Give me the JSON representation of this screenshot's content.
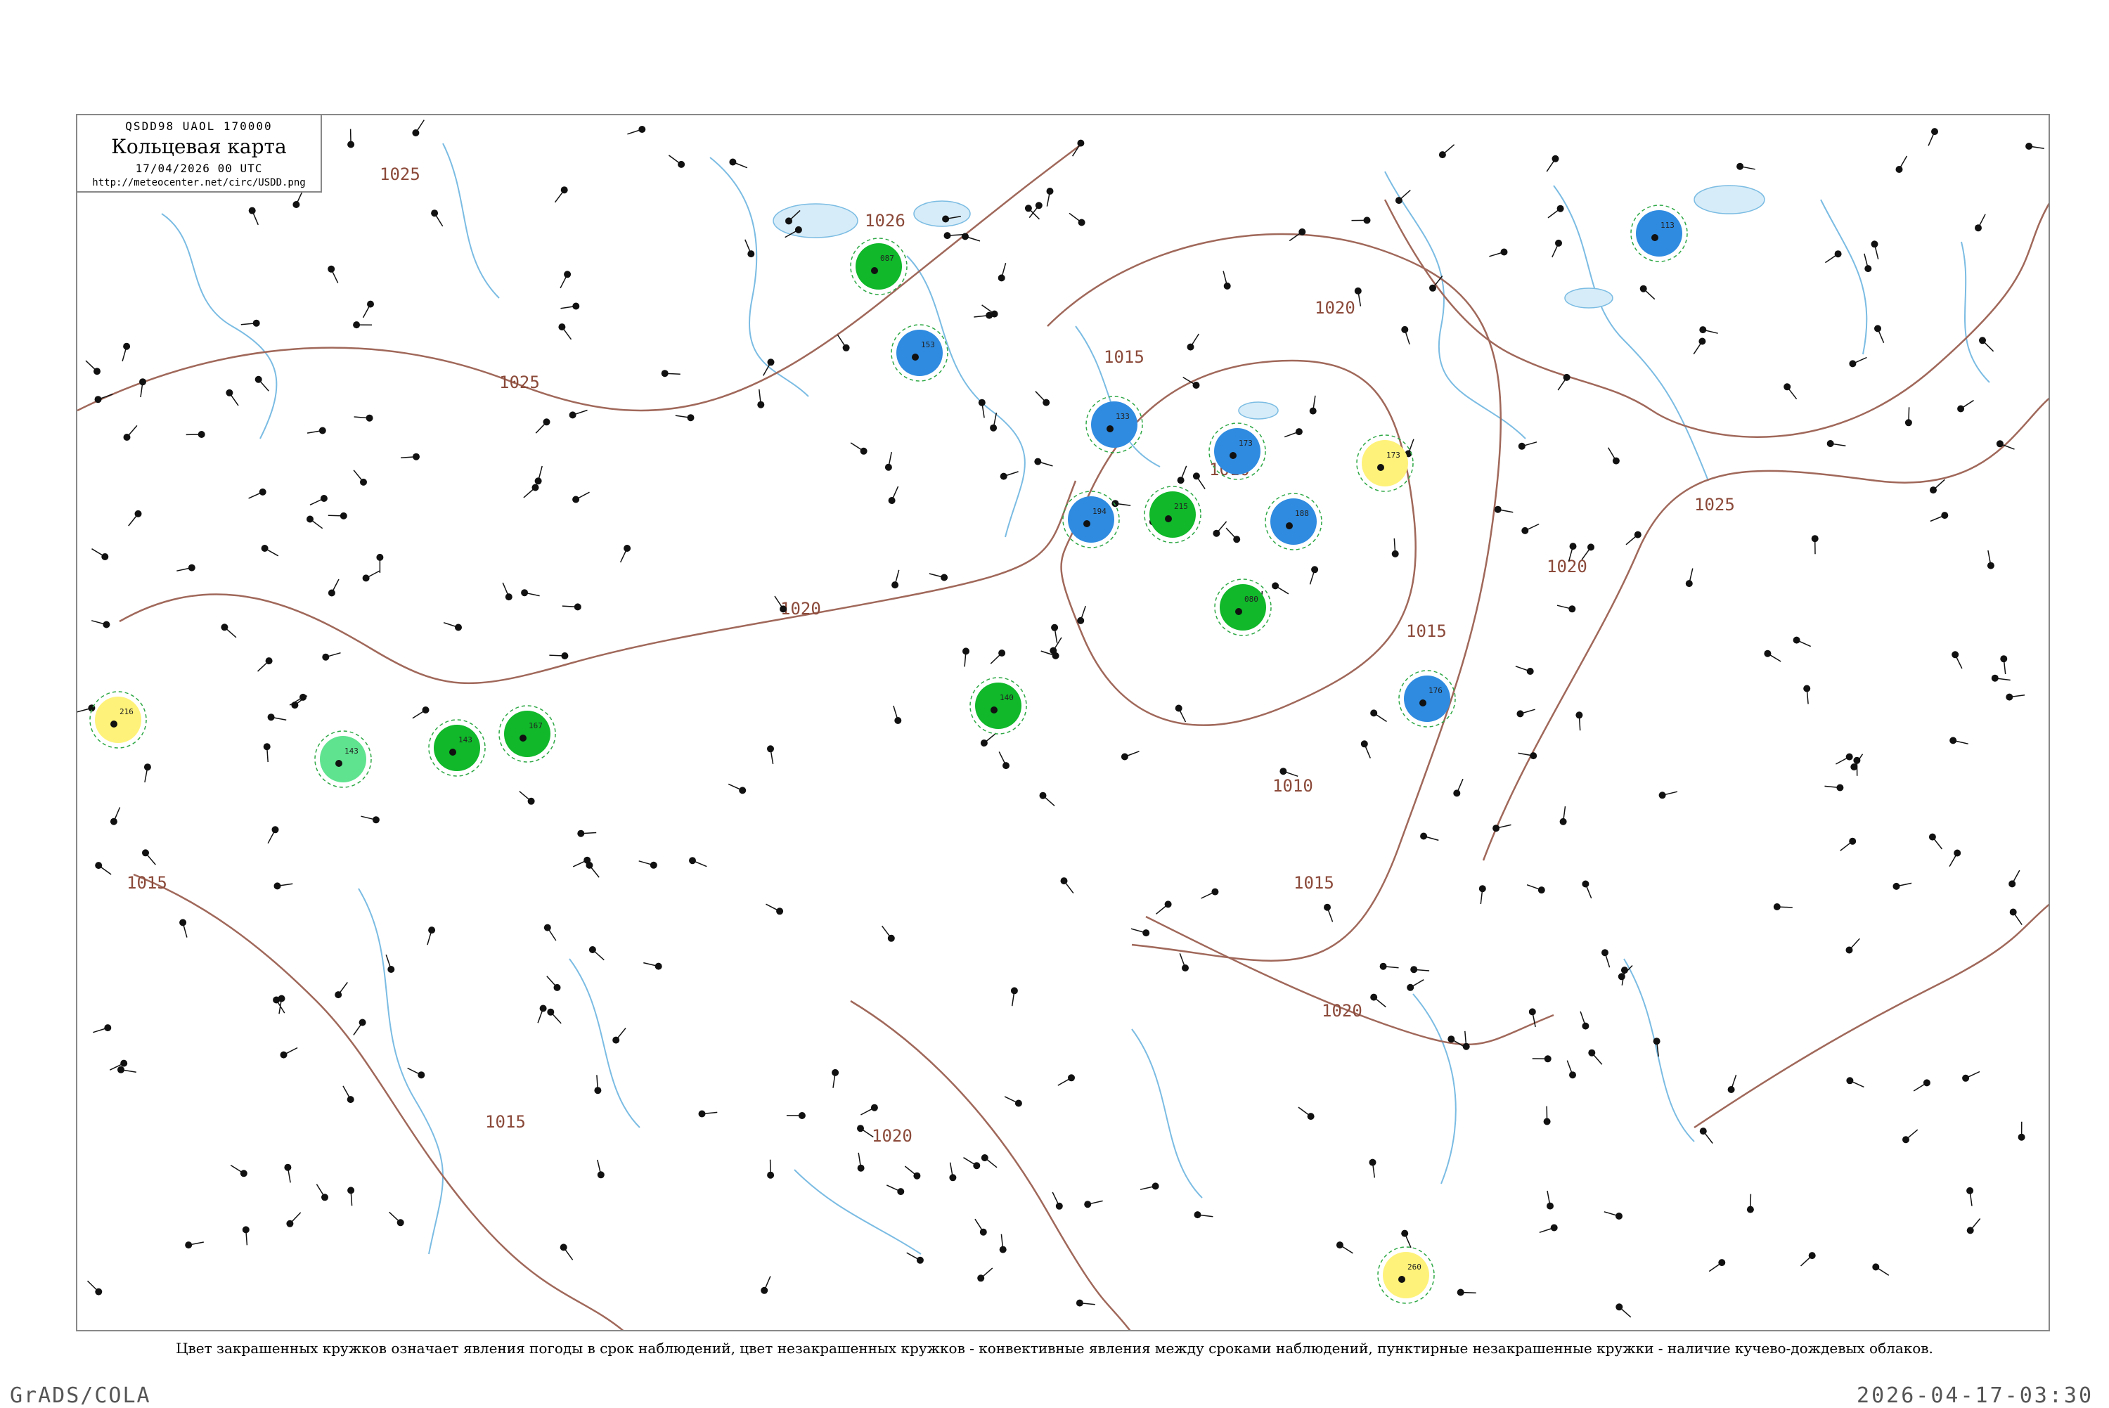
{
  "legend": {
    "code": "QSDD98 UAOL 170000",
    "title": "Кольцевая карта",
    "date": "17/04/2026 00 UTC",
    "url": "http://meteocenter.net/circ/USDD.png"
  },
  "isobars": [
    {
      "label": "1025",
      "pos": "north-west"
    },
    {
      "label": "1026",
      "pos": "north-center"
    },
    {
      "label": "1025",
      "pos": "west-center"
    },
    {
      "label": "1020",
      "pos": "center"
    },
    {
      "label": "1015",
      "pos": "center-north"
    },
    {
      "label": "1010",
      "pos": "center-east"
    },
    {
      "label": "1020",
      "pos": "north-east"
    },
    {
      "label": "1015",
      "pos": "east"
    },
    {
      "label": "1020",
      "pos": "east-center"
    },
    {
      "label": "1025",
      "pos": "far-east"
    },
    {
      "label": "1015",
      "pos": "west"
    },
    {
      "label": "1010",
      "pos": "south-center"
    },
    {
      "label": "1015",
      "pos": "south-center-east"
    },
    {
      "label": "1020",
      "pos": "south-east"
    },
    {
      "label": "1015",
      "pos": "south-west"
    },
    {
      "label": "1020",
      "pos": "south"
    }
  ],
  "stations": [
    {
      "id": "s1",
      "fill": "blue",
      "value": "113"
    },
    {
      "id": "s2",
      "fill": "green",
      "value": "087"
    },
    {
      "id": "s3",
      "fill": "blue",
      "value": "153"
    },
    {
      "id": "s4",
      "fill": "blue",
      "value": "133"
    },
    {
      "id": "s5",
      "fill": "blue",
      "value": "194"
    },
    {
      "id": "s6",
      "fill": "yellow",
      "value": "173"
    },
    {
      "id": "s7",
      "fill": "green",
      "value": "215"
    },
    {
      "id": "s8",
      "fill": "blue",
      "value": "173"
    },
    {
      "id": "s9",
      "fill": "blue",
      "value": "188"
    },
    {
      "id": "s10",
      "fill": "green",
      "value": "080"
    },
    {
      "id": "s11",
      "fill": "green",
      "value": "140"
    },
    {
      "id": "s12",
      "fill": "blue",
      "value": "176"
    },
    {
      "id": "s13",
      "fill": "yellow",
      "value": "216"
    },
    {
      "id": "s14",
      "fill": "yellow",
      "value": "260"
    },
    {
      "id": "s15",
      "fill": "teal",
      "value": "143"
    },
    {
      "id": "s16",
      "fill": "green",
      "value": "143"
    },
    {
      "id": "s17",
      "fill": "green",
      "value": "167"
    }
  ],
  "caption": "Цвет закрашенных кружков означает явления погоды в срок наблюдений, цвет незакрашенных кружков - конвективные явления между сроками наблюдений, пунктирные незакрашенные кружки - наличие кучево-дождевых облаков.",
  "footer": {
    "left": "GrADS/COLA",
    "right": "2026-04-17-03:30"
  },
  "colors": {
    "isobar": "#a0685a",
    "river": "#5ba8d6",
    "blue": "#2f8be0",
    "green": "#10b82a",
    "yellow": "#fff27a",
    "teal": "#5fe38f",
    "outline": "#2ea845"
  }
}
